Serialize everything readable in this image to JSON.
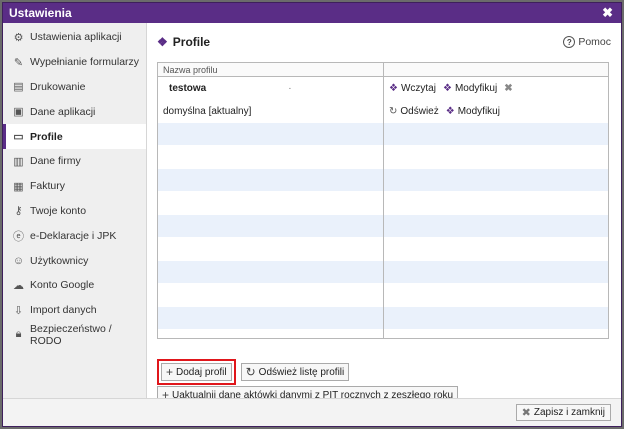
{
  "window": {
    "title": "Ustawienia",
    "close_icon": "close-icon"
  },
  "sidebar": {
    "items": [
      {
        "label": "Ustawienia aplikacji",
        "icon": "gear-icon"
      },
      {
        "label": "Wypełnianie formularzy",
        "icon": "pencil-icon"
      },
      {
        "label": "Drukowanie",
        "icon": "printer-icon"
      },
      {
        "label": "Dane aplikacji",
        "icon": "disk-icon"
      },
      {
        "label": "Profile",
        "icon": "folder-icon"
      },
      {
        "label": "Dane firmy",
        "icon": "building-icon"
      },
      {
        "label": "Faktury",
        "icon": "invoice-icon"
      },
      {
        "label": "Twoje konto",
        "icon": "key-icon"
      },
      {
        "label": "e-Deklaracje i JPK",
        "icon": "e-icon"
      },
      {
        "label": "Użytkownicy",
        "icon": "users-icon"
      },
      {
        "label": "Konto Google",
        "icon": "cloud-icon"
      },
      {
        "label": "Import danych",
        "icon": "import-icon"
      },
      {
        "label": "Bezpieczeństwo / RODO",
        "icon": "lock-icon"
      }
    ],
    "active_index": 4
  },
  "main": {
    "title": "Profile",
    "help_label": "Pomoc",
    "table": {
      "column_header": "Nazwa profilu",
      "rows": [
        {
          "name": "testowa",
          "marker": "·",
          "actions": [
            "Wczytaj",
            "Modyfikuj"
          ]
        },
        {
          "name": "domyślna [aktualny]",
          "actions": [
            "Odśwież",
            "Modyfikuj"
          ]
        }
      ]
    },
    "buttons": {
      "add_profile": "Dodaj profil",
      "refresh_list": "Odśwież listę profili",
      "update_pit": "Uaktualnij dane aktówki danymi z PIT rocznych z zeszłego roku"
    }
  },
  "footer": {
    "save_close": "Zapisz i zamknij"
  },
  "colors": {
    "accent": "#5a2d86",
    "highlight": "#e0161b",
    "row_alt": "#eaf1fb"
  }
}
